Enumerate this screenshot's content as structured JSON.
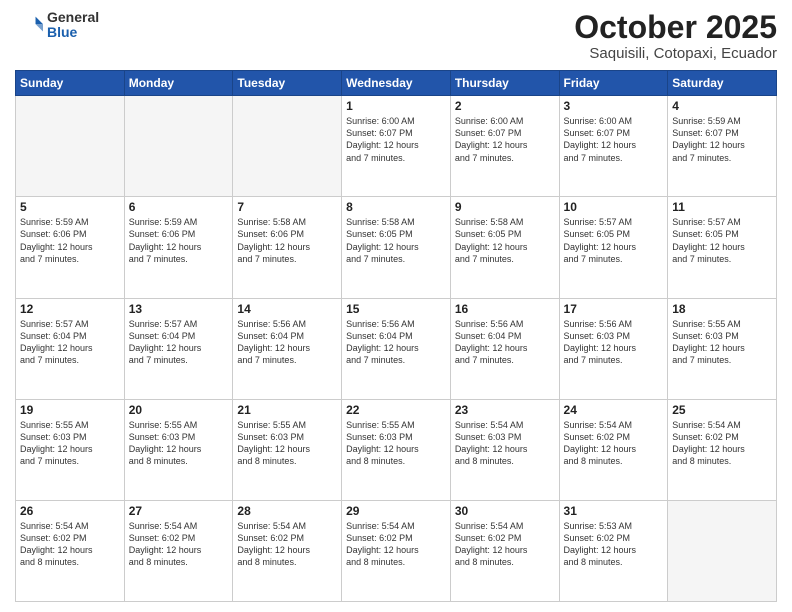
{
  "logo": {
    "general": "General",
    "blue": "Blue"
  },
  "title": {
    "month": "October 2025",
    "location": "Saquisili, Cotopaxi, Ecuador"
  },
  "days_of_week": [
    "Sunday",
    "Monday",
    "Tuesday",
    "Wednesday",
    "Thursday",
    "Friday",
    "Saturday"
  ],
  "weeks": [
    [
      {
        "day": "",
        "info": ""
      },
      {
        "day": "",
        "info": ""
      },
      {
        "day": "",
        "info": ""
      },
      {
        "day": "1",
        "info": "Sunrise: 6:00 AM\nSunset: 6:07 PM\nDaylight: 12 hours\nand 7 minutes."
      },
      {
        "day": "2",
        "info": "Sunrise: 6:00 AM\nSunset: 6:07 PM\nDaylight: 12 hours\nand 7 minutes."
      },
      {
        "day": "3",
        "info": "Sunrise: 6:00 AM\nSunset: 6:07 PM\nDaylight: 12 hours\nand 7 minutes."
      },
      {
        "day": "4",
        "info": "Sunrise: 5:59 AM\nSunset: 6:07 PM\nDaylight: 12 hours\nand 7 minutes."
      }
    ],
    [
      {
        "day": "5",
        "info": "Sunrise: 5:59 AM\nSunset: 6:06 PM\nDaylight: 12 hours\nand 7 minutes."
      },
      {
        "day": "6",
        "info": "Sunrise: 5:59 AM\nSunset: 6:06 PM\nDaylight: 12 hours\nand 7 minutes."
      },
      {
        "day": "7",
        "info": "Sunrise: 5:58 AM\nSunset: 6:06 PM\nDaylight: 12 hours\nand 7 minutes."
      },
      {
        "day": "8",
        "info": "Sunrise: 5:58 AM\nSunset: 6:05 PM\nDaylight: 12 hours\nand 7 minutes."
      },
      {
        "day": "9",
        "info": "Sunrise: 5:58 AM\nSunset: 6:05 PM\nDaylight: 12 hours\nand 7 minutes."
      },
      {
        "day": "10",
        "info": "Sunrise: 5:57 AM\nSunset: 6:05 PM\nDaylight: 12 hours\nand 7 minutes."
      },
      {
        "day": "11",
        "info": "Sunrise: 5:57 AM\nSunset: 6:05 PM\nDaylight: 12 hours\nand 7 minutes."
      }
    ],
    [
      {
        "day": "12",
        "info": "Sunrise: 5:57 AM\nSunset: 6:04 PM\nDaylight: 12 hours\nand 7 minutes."
      },
      {
        "day": "13",
        "info": "Sunrise: 5:57 AM\nSunset: 6:04 PM\nDaylight: 12 hours\nand 7 minutes."
      },
      {
        "day": "14",
        "info": "Sunrise: 5:56 AM\nSunset: 6:04 PM\nDaylight: 12 hours\nand 7 minutes."
      },
      {
        "day": "15",
        "info": "Sunrise: 5:56 AM\nSunset: 6:04 PM\nDaylight: 12 hours\nand 7 minutes."
      },
      {
        "day": "16",
        "info": "Sunrise: 5:56 AM\nSunset: 6:04 PM\nDaylight: 12 hours\nand 7 minutes."
      },
      {
        "day": "17",
        "info": "Sunrise: 5:56 AM\nSunset: 6:03 PM\nDaylight: 12 hours\nand 7 minutes."
      },
      {
        "day": "18",
        "info": "Sunrise: 5:55 AM\nSunset: 6:03 PM\nDaylight: 12 hours\nand 7 minutes."
      }
    ],
    [
      {
        "day": "19",
        "info": "Sunrise: 5:55 AM\nSunset: 6:03 PM\nDaylight: 12 hours\nand 7 minutes."
      },
      {
        "day": "20",
        "info": "Sunrise: 5:55 AM\nSunset: 6:03 PM\nDaylight: 12 hours\nand 8 minutes."
      },
      {
        "day": "21",
        "info": "Sunrise: 5:55 AM\nSunset: 6:03 PM\nDaylight: 12 hours\nand 8 minutes."
      },
      {
        "day": "22",
        "info": "Sunrise: 5:55 AM\nSunset: 6:03 PM\nDaylight: 12 hours\nand 8 minutes."
      },
      {
        "day": "23",
        "info": "Sunrise: 5:54 AM\nSunset: 6:03 PM\nDaylight: 12 hours\nand 8 minutes."
      },
      {
        "day": "24",
        "info": "Sunrise: 5:54 AM\nSunset: 6:02 PM\nDaylight: 12 hours\nand 8 minutes."
      },
      {
        "day": "25",
        "info": "Sunrise: 5:54 AM\nSunset: 6:02 PM\nDaylight: 12 hours\nand 8 minutes."
      }
    ],
    [
      {
        "day": "26",
        "info": "Sunrise: 5:54 AM\nSunset: 6:02 PM\nDaylight: 12 hours\nand 8 minutes."
      },
      {
        "day": "27",
        "info": "Sunrise: 5:54 AM\nSunset: 6:02 PM\nDaylight: 12 hours\nand 8 minutes."
      },
      {
        "day": "28",
        "info": "Sunrise: 5:54 AM\nSunset: 6:02 PM\nDaylight: 12 hours\nand 8 minutes."
      },
      {
        "day": "29",
        "info": "Sunrise: 5:54 AM\nSunset: 6:02 PM\nDaylight: 12 hours\nand 8 minutes."
      },
      {
        "day": "30",
        "info": "Sunrise: 5:54 AM\nSunset: 6:02 PM\nDaylight: 12 hours\nand 8 minutes."
      },
      {
        "day": "31",
        "info": "Sunrise: 5:53 AM\nSunset: 6:02 PM\nDaylight: 12 hours\nand 8 minutes."
      },
      {
        "day": "",
        "info": ""
      }
    ]
  ]
}
